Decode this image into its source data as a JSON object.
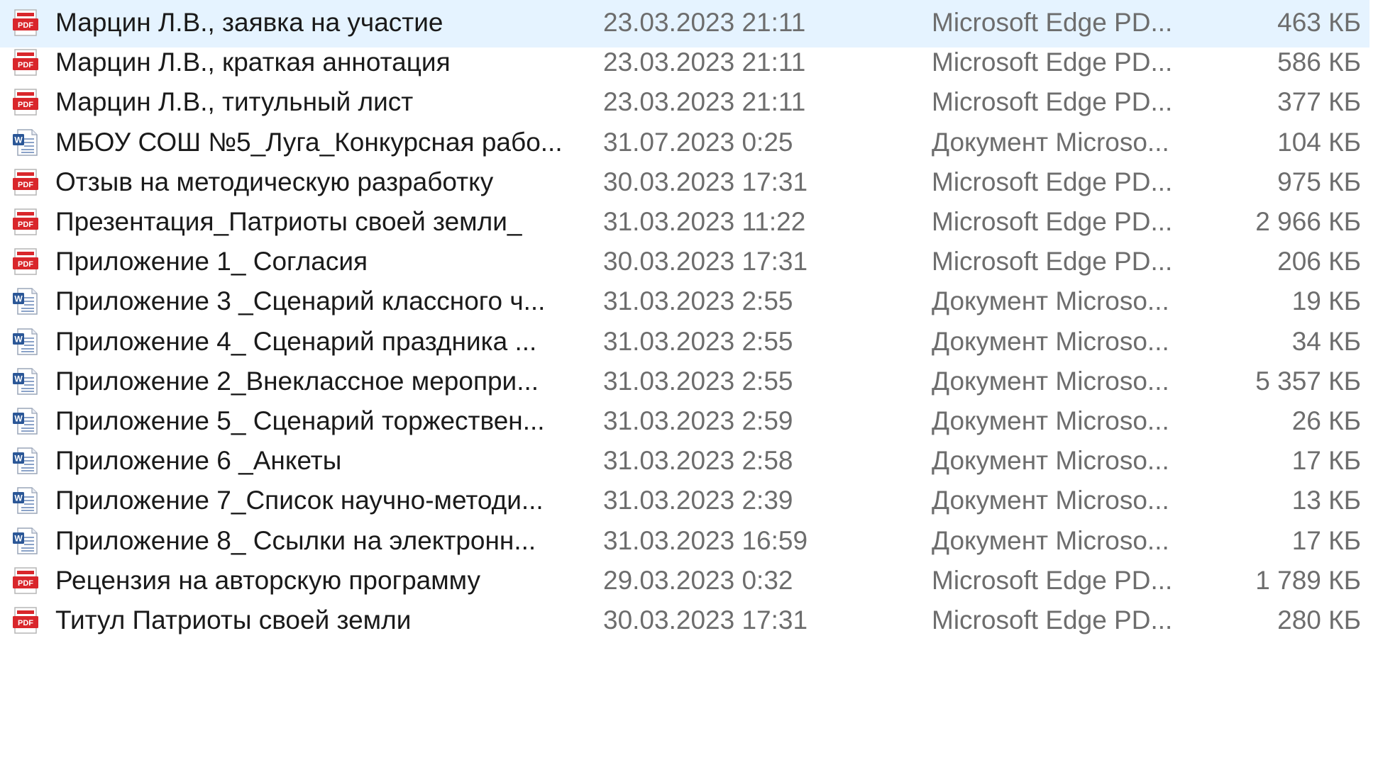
{
  "files": [
    {
      "name": "Марцин Л.В., заявка на участие",
      "date": "23.03.2023 21:11",
      "type": "Microsoft Edge PD...",
      "size": "463 КБ",
      "icon": "pdf-file-icon",
      "selected": true
    },
    {
      "name": "Марцин Л.В., краткая аннотация",
      "date": "23.03.2023 21:11",
      "type": "Microsoft Edge PD...",
      "size": "586 КБ",
      "icon": "pdf-file-icon"
    },
    {
      "name": "Марцин Л.В., титульный лист",
      "date": "23.03.2023 21:11",
      "type": "Microsoft Edge PD...",
      "size": "377 КБ",
      "icon": "pdf-file-icon"
    },
    {
      "name": "МБОУ СОШ №5_Луга_Конкурсная рабо...",
      "date": "31.07.2023 0:25",
      "type": "Документ Microso...",
      "size": "104 КБ",
      "icon": "word-file-icon"
    },
    {
      "name": "Отзыв на методическую разработку",
      "date": "30.03.2023 17:31",
      "type": "Microsoft Edge PD...",
      "size": "975 КБ",
      "icon": "pdf-file-icon"
    },
    {
      "name": "Презентация_Патриоты своей земли_",
      "date": "31.03.2023 11:22",
      "type": "Microsoft Edge PD...",
      "size": "2 966 КБ",
      "icon": "pdf-file-icon"
    },
    {
      "name": "Приложение  1_ Согласия",
      "date": "30.03.2023 17:31",
      "type": "Microsoft Edge PD...",
      "size": "206 КБ",
      "icon": "pdf-file-icon"
    },
    {
      "name": "Приложение  3 _Сценарий классного ч...",
      "date": "31.03.2023 2:55",
      "type": "Документ Microso...",
      "size": "19 КБ",
      "icon": "word-file-icon"
    },
    {
      "name": "Приложение  4_ Сценарий праздника ...",
      "date": "31.03.2023 2:55",
      "type": "Документ Microso...",
      "size": "34 КБ",
      "icon": "word-file-icon"
    },
    {
      "name": "Приложение 2_Внеклассное меропри...",
      "date": "31.03.2023 2:55",
      "type": "Документ Microso...",
      "size": "5 357 КБ",
      "icon": "word-file-icon"
    },
    {
      "name": "Приложение 5_ Сценарий торжествен...",
      "date": "31.03.2023 2:59",
      "type": "Документ Microso...",
      "size": "26 КБ",
      "icon": "word-file-icon"
    },
    {
      "name": "Приложение 6 _Анкеты",
      "date": "31.03.2023 2:58",
      "type": "Документ Microso...",
      "size": "17 КБ",
      "icon": "word-file-icon"
    },
    {
      "name": "Приложение 7_Список научно-методи...",
      "date": "31.03.2023 2:39",
      "type": "Документ Microso...",
      "size": "13 КБ",
      "icon": "word-file-icon"
    },
    {
      "name": "Приложение 8_ Ссылки  на электронн...",
      "date": "31.03.2023 16:59",
      "type": "Документ Microso...",
      "size": "17 КБ",
      "icon": "word-file-icon"
    },
    {
      "name": "Рецензия на авторскую программу",
      "date": "29.03.2023 0:32",
      "type": "Microsoft Edge PD...",
      "size": "1 789 КБ",
      "icon": "pdf-file-icon"
    },
    {
      "name": "Титул Патриоты своей земли",
      "date": "30.03.2023 17:31",
      "type": "Microsoft Edge PD...",
      "size": "280 КБ",
      "icon": "pdf-file-icon"
    }
  ],
  "colors": {
    "selected_row": "#e5f3ff",
    "pdf_red": "#d9262b",
    "word_blue": "#2b5797",
    "secondary_text": "#6d6d6d"
  }
}
